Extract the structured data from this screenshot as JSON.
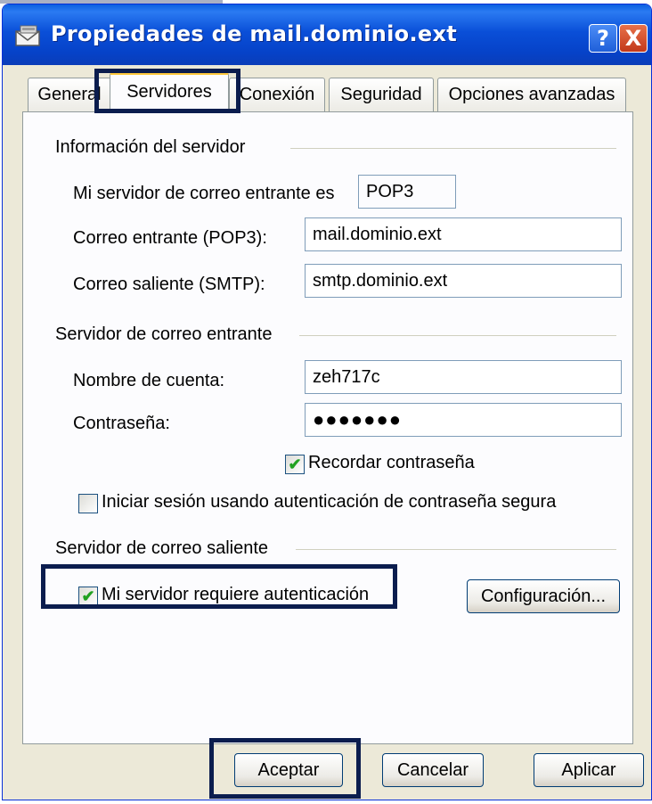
{
  "window": {
    "title": "Propiedades de mail.dominio.ext",
    "icon": "mail-envelope-icon",
    "help_label": "?",
    "close_label": "X"
  },
  "tabs": [
    {
      "label": "General",
      "active": false
    },
    {
      "label": "Servidores",
      "active": true
    },
    {
      "label": "Conexión",
      "active": false
    },
    {
      "label": "Seguridad",
      "active": false
    },
    {
      "label": "Opciones avanzadas",
      "active": false
    }
  ],
  "server_info": {
    "group_title": "Información del servidor",
    "incoming_type_label": "Mi servidor de correo entrante es",
    "incoming_type_value": "POP3",
    "incoming_label": "Correo entrante (POP3):",
    "incoming_value": "mail.dominio.ext",
    "outgoing_label": "Correo saliente (SMTP):",
    "outgoing_value": "smtp.dominio.ext"
  },
  "incoming_server": {
    "group_title": "Servidor de correo entrante",
    "account_label": "Nombre de cuenta:",
    "account_value": "zeh717c",
    "password_label": "Contraseña:",
    "password_value": "●●●●●●●",
    "remember_label": "Recordar contraseña",
    "remember_checked": true,
    "spa_label": "Iniciar sesión usando autenticación de contraseña segura",
    "spa_checked": false
  },
  "outgoing_server": {
    "group_title": "Servidor de correo saliente",
    "auth_label": "Mi servidor requiere autenticación",
    "auth_checked": true,
    "settings_button": "Configuración..."
  },
  "buttons": {
    "ok": "Aceptar",
    "cancel": "Cancelar",
    "apply": "Aplicar"
  },
  "colors": {
    "titlebar": "#0A4FD8",
    "dialog_bg": "#ECE9D8",
    "highlight": "#0B1D4E",
    "check": "#21A121"
  }
}
